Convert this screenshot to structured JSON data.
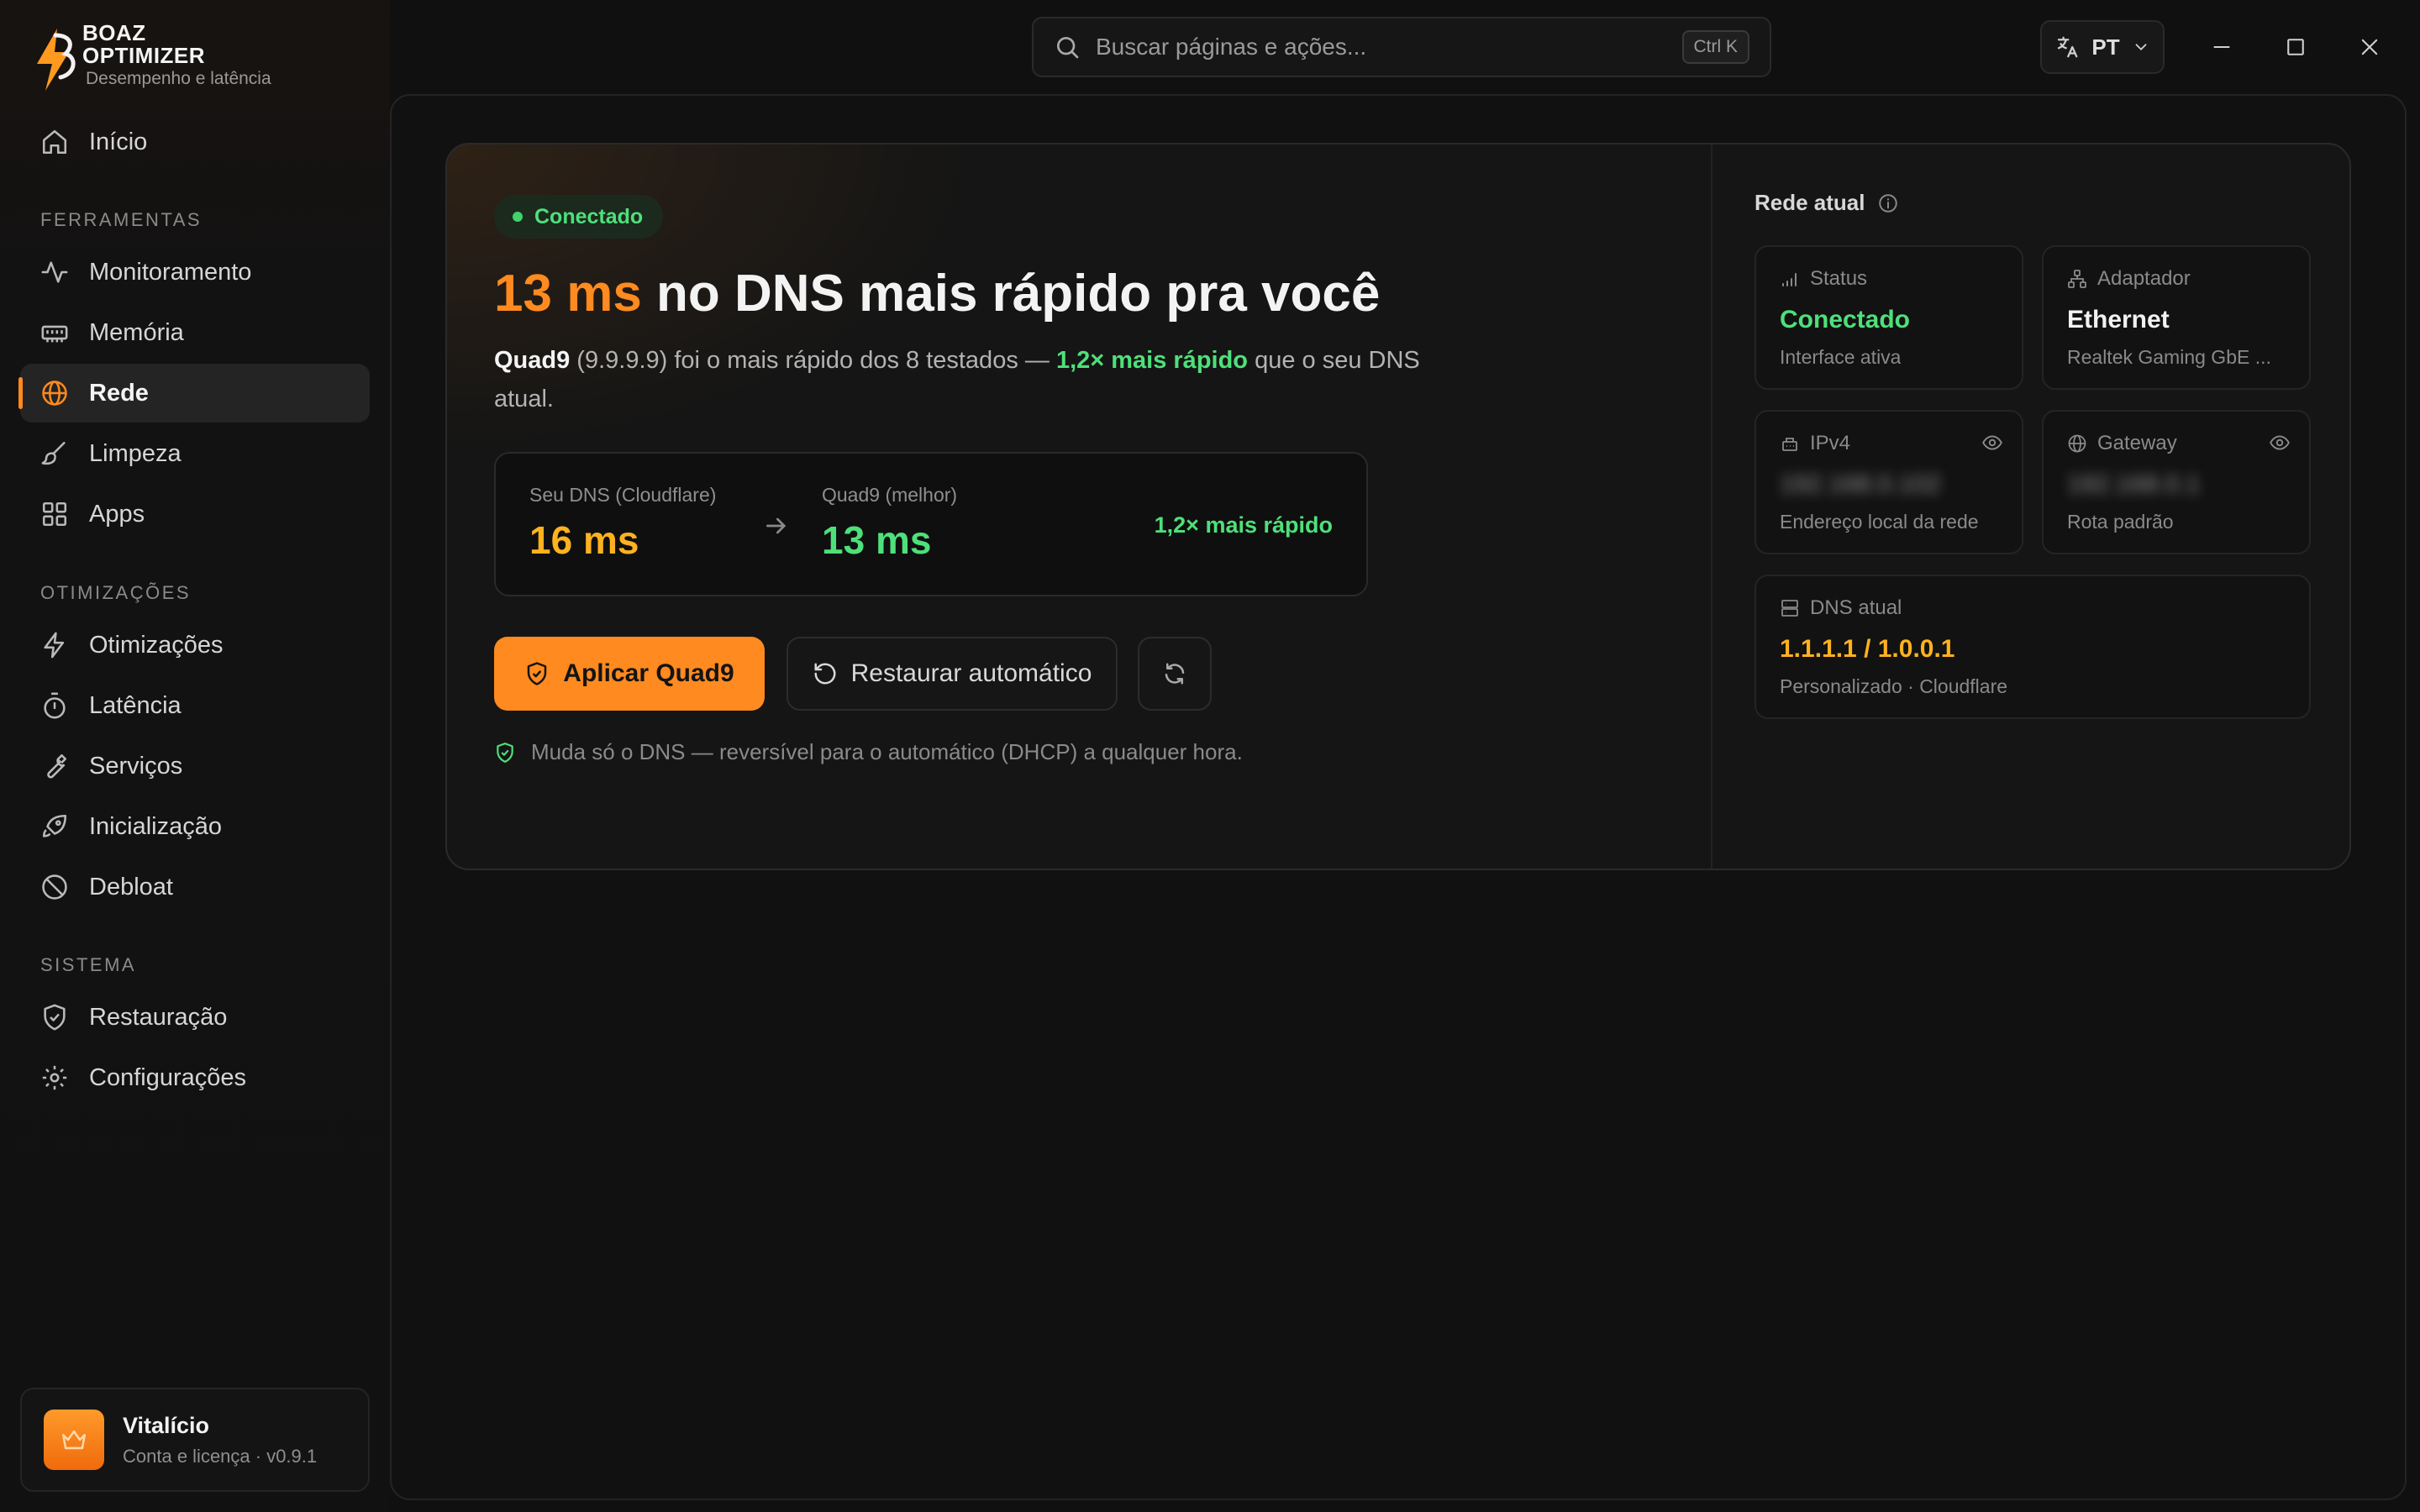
{
  "brand": {
    "name_line1": "BOAZ",
    "name_line2": "OPTIMIZER",
    "tagline": "Desempenho e latência"
  },
  "nav": {
    "home": "Início",
    "sections": {
      "tools": "FERRAMENTAS",
      "optimizations": "OTIMIZAÇÕES",
      "system": "SISTEMA"
    },
    "items": {
      "monitoring": "Monitoramento",
      "memory": "Memória",
      "network": "Rede",
      "cleanup": "Limpeza",
      "apps": "Apps",
      "optimizations": "Otimizações",
      "latency": "Latência",
      "services": "Serviços",
      "startup": "Inicialização",
      "debloat": "Debloat",
      "restore": "Restauração",
      "settings": "Configurações"
    },
    "active": "network"
  },
  "license": {
    "name": "Vitalício",
    "subtitle": "Conta e licença · v0.9.1"
  },
  "titlebar": {
    "search_placeholder": "Buscar páginas e ações...",
    "search_value": "",
    "shortcut": "Ctrl K",
    "language": "PT"
  },
  "dns_card": {
    "status_badge": "Conectado",
    "headline_value": "13 ms",
    "headline_rest": " no DNS mais rápido pra você",
    "desc_provider": "Quad9",
    "desc_ip": " (9.9.9.9) foi o mais rápido dos 8 testados — ",
    "desc_speedup": "1,2× mais rápido",
    "desc_tail": " que o seu DNS atual.",
    "compare": {
      "current_label": "Seu DNS (Cloudflare)",
      "current_value": "16 ms",
      "best_label": "Quad9 (melhor)",
      "best_value": "13 ms",
      "speedup": "1,2× mais rápido"
    },
    "apply_button": "Aplicar Quad9",
    "restore_button": "Restaurar automático",
    "note": "Muda só o DNS — reversível para o automático (DHCP) a qualquer hora."
  },
  "network_panel": {
    "title": "Rede atual",
    "status": {
      "label": "Status",
      "value": "Conectado",
      "sub": "Interface ativa"
    },
    "adapter": {
      "label": "Adaptador",
      "value": "Ethernet",
      "sub": "Realtek Gaming GbE ..."
    },
    "ipv4": {
      "label": "IPv4",
      "value": "192.168.0.102",
      "sub": "Endereço local da rede"
    },
    "gateway": {
      "label": "Gateway",
      "value": "192.168.0.1",
      "sub": "Rota padrão"
    },
    "dns": {
      "label": "DNS atual",
      "value": "1.1.1.1 / 1.0.0.1",
      "sub": "Personalizado · Cloudflare"
    }
  },
  "colors": {
    "accent": "#ff8a1f",
    "success": "#4ee07a",
    "dns_value": "#ffb21f",
    "background": "#101010"
  }
}
